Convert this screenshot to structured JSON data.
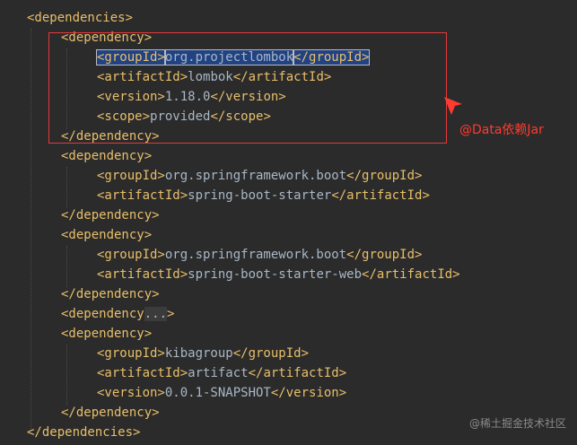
{
  "code_lines": [
    [
      {
        "t": "tag",
        "v": "<dependencies>"
      }
    ],
    [
      {
        "t": "tag",
        "v": "<dependency>"
      }
    ],
    [
      {
        "t": "sel",
        "v": "<groupId>"
      },
      {
        "t": "sel-text",
        "v": "org.projectlombok"
      },
      {
        "t": "sel",
        "v": "</groupId>"
      }
    ],
    [
      {
        "t": "tag",
        "v": "<artifactId>"
      },
      {
        "t": "text",
        "v": "lombok"
      },
      {
        "t": "tag",
        "v": "</artifactId>"
      }
    ],
    [
      {
        "t": "tag",
        "v": "<version>"
      },
      {
        "t": "text",
        "v": "1.18.0"
      },
      {
        "t": "tag",
        "v": "</version>"
      }
    ],
    [
      {
        "t": "tag",
        "v": "<scope>"
      },
      {
        "t": "text",
        "v": "provided"
      },
      {
        "t": "tag",
        "v": "</scope>"
      }
    ],
    [
      {
        "t": "tag",
        "v": "</dependency>"
      }
    ],
    [
      {
        "t": "tag",
        "v": "<dependency>"
      }
    ],
    [
      {
        "t": "tag",
        "v": "<groupId>"
      },
      {
        "t": "text",
        "v": "org.springframework.boot"
      },
      {
        "t": "tag",
        "v": "</groupId>"
      }
    ],
    [
      {
        "t": "tag",
        "v": "<artifactId>"
      },
      {
        "t": "text",
        "v": "spring-boot-starter"
      },
      {
        "t": "tag",
        "v": "</artifactId>"
      }
    ],
    [
      {
        "t": "tag",
        "v": "</dependency>"
      }
    ],
    [
      {
        "t": "tag",
        "v": "<dependency>"
      }
    ],
    [
      {
        "t": "tag",
        "v": "<groupId>"
      },
      {
        "t": "text",
        "v": "org.springframework.boot"
      },
      {
        "t": "tag",
        "v": "</groupId>"
      }
    ],
    [
      {
        "t": "tag",
        "v": "<artifactId>"
      },
      {
        "t": "text",
        "v": "spring-boot-starter-web"
      },
      {
        "t": "tag",
        "v": "</artifactId>"
      }
    ],
    [
      {
        "t": "tag",
        "v": "</dependency>"
      }
    ],
    [
      {
        "t": "tag",
        "v": "<dependency"
      },
      {
        "t": "fold",
        "v": "..."
      },
      {
        "t": "tag",
        "v": ">"
      }
    ],
    [
      {
        "t": "tag",
        "v": "<dependency>"
      }
    ],
    [
      {
        "t": "tag",
        "v": "<groupId>"
      },
      {
        "t": "text",
        "v": "kibagroup"
      },
      {
        "t": "tag",
        "v": "</groupId>"
      }
    ],
    [
      {
        "t": "tag",
        "v": "<artifactId>"
      },
      {
        "t": "text",
        "v": "artifact"
      },
      {
        "t": "tag",
        "v": "</artifactId>"
      }
    ],
    [
      {
        "t": "tag",
        "v": "<version>"
      },
      {
        "t": "text",
        "v": "0.0.1-SNAPSHOT"
      },
      {
        "t": "tag",
        "v": "</version>"
      }
    ],
    [
      {
        "t": "tag",
        "v": "</dependency>"
      }
    ],
    [
      {
        "t": "tag",
        "v": "</dependencies>"
      }
    ]
  ],
  "annotation": {
    "label": "@Data依赖Jar",
    "color": "#ff3b30"
  },
  "watermark": "@稀土掘金技术社区",
  "colors": {
    "background": "#2b2b2b",
    "tag": "#e8bf6a",
    "text": "#a9b7c6",
    "selection": "#214283"
  }
}
